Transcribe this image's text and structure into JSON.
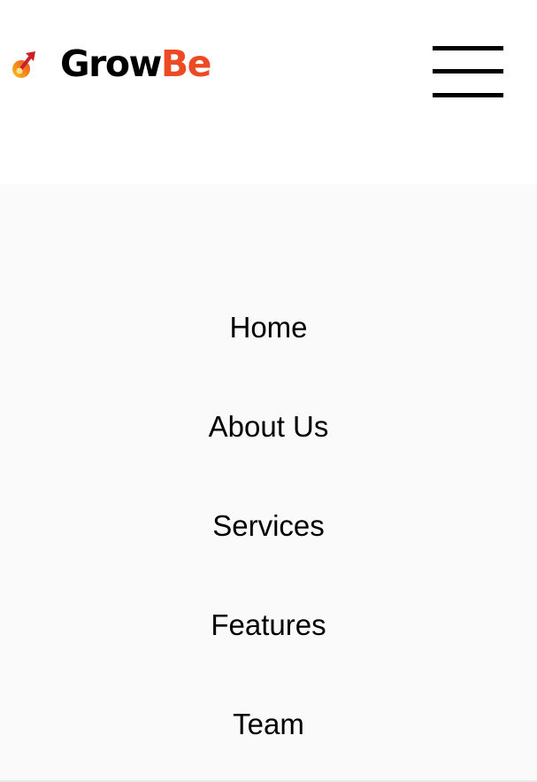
{
  "header": {
    "brand": {
      "part1": "Grow",
      "part2": "Be",
      "icon": "rocket-icon",
      "accent_color": "#ed4a23"
    },
    "menu_button_icon": "hamburger-icon"
  },
  "nav": {
    "items": [
      {
        "label": "Home"
      },
      {
        "label": "About Us"
      },
      {
        "label": "Services"
      },
      {
        "label": "Features"
      },
      {
        "label": "Team"
      }
    ]
  },
  "colors": {
    "panel_background": "#fafafa",
    "text": "#000000",
    "accent": "#ed4a23"
  }
}
